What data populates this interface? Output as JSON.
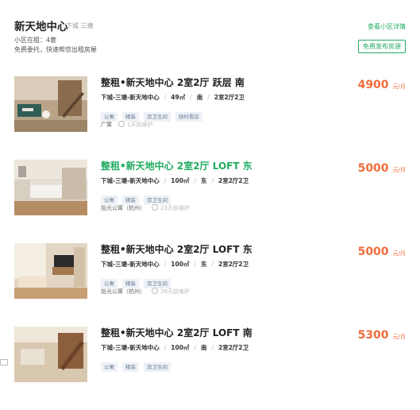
{
  "header": {
    "title": "新天地中心",
    "district": "下城 三塘",
    "on_rent": "小区在租：4套",
    "tagline": "免费委托，快速帮您出租房屋",
    "detail_link": "查看小区详情",
    "publish_button": "免费发布房源"
  },
  "listings": [
    {
      "title": "整租•新天地中心 2室2厅 跃层 南",
      "area": "下城-三塘-新天地中心",
      "size": "49㎡",
      "orientation": "南",
      "layout": "2室2厅2卫",
      "tags": [
        "公寓",
        "精装",
        "双卫生间",
        "随时看房"
      ],
      "agent": "广寓",
      "updated": "1天前维护",
      "price": "4900",
      "unit": "元/月",
      "highlight": false
    },
    {
      "title": "整租•新天地中心 2室2厅 LOFT 东",
      "area": "下城-三塘-新天地中心",
      "size": "100㎡",
      "orientation": "东",
      "layout": "2室2厅2卫",
      "tags": [
        "公寓",
        "精装",
        "双卫生间"
      ],
      "agent": "抬光公寓（杭州）",
      "updated": "23天前维护",
      "price": "5000",
      "unit": "元/月",
      "highlight": true
    },
    {
      "title": "整租•新天地中心 2室2厅 LOFT 东",
      "area": "下城-三塘-新天地中心",
      "size": "100㎡",
      "orientation": "东",
      "layout": "2室2厅2卫",
      "tags": [
        "公寓",
        "精装",
        "双卫生间"
      ],
      "agent": "抬光公寓（杭州）",
      "updated": "26天前维护",
      "price": "5000",
      "unit": "元/月",
      "highlight": false
    },
    {
      "title": "整租•新天地中心 2室2厅 LOFT 南",
      "area": "下城-三塘-新天地中心",
      "size": "100㎡",
      "orientation": "南",
      "layout": "2室2厅2卫",
      "tags": [
        "公寓",
        "精装",
        "双卫生间"
      ],
      "agent": "",
      "updated": "",
      "price": "5300",
      "unit": "元/月",
      "highlight": false
    }
  ]
}
